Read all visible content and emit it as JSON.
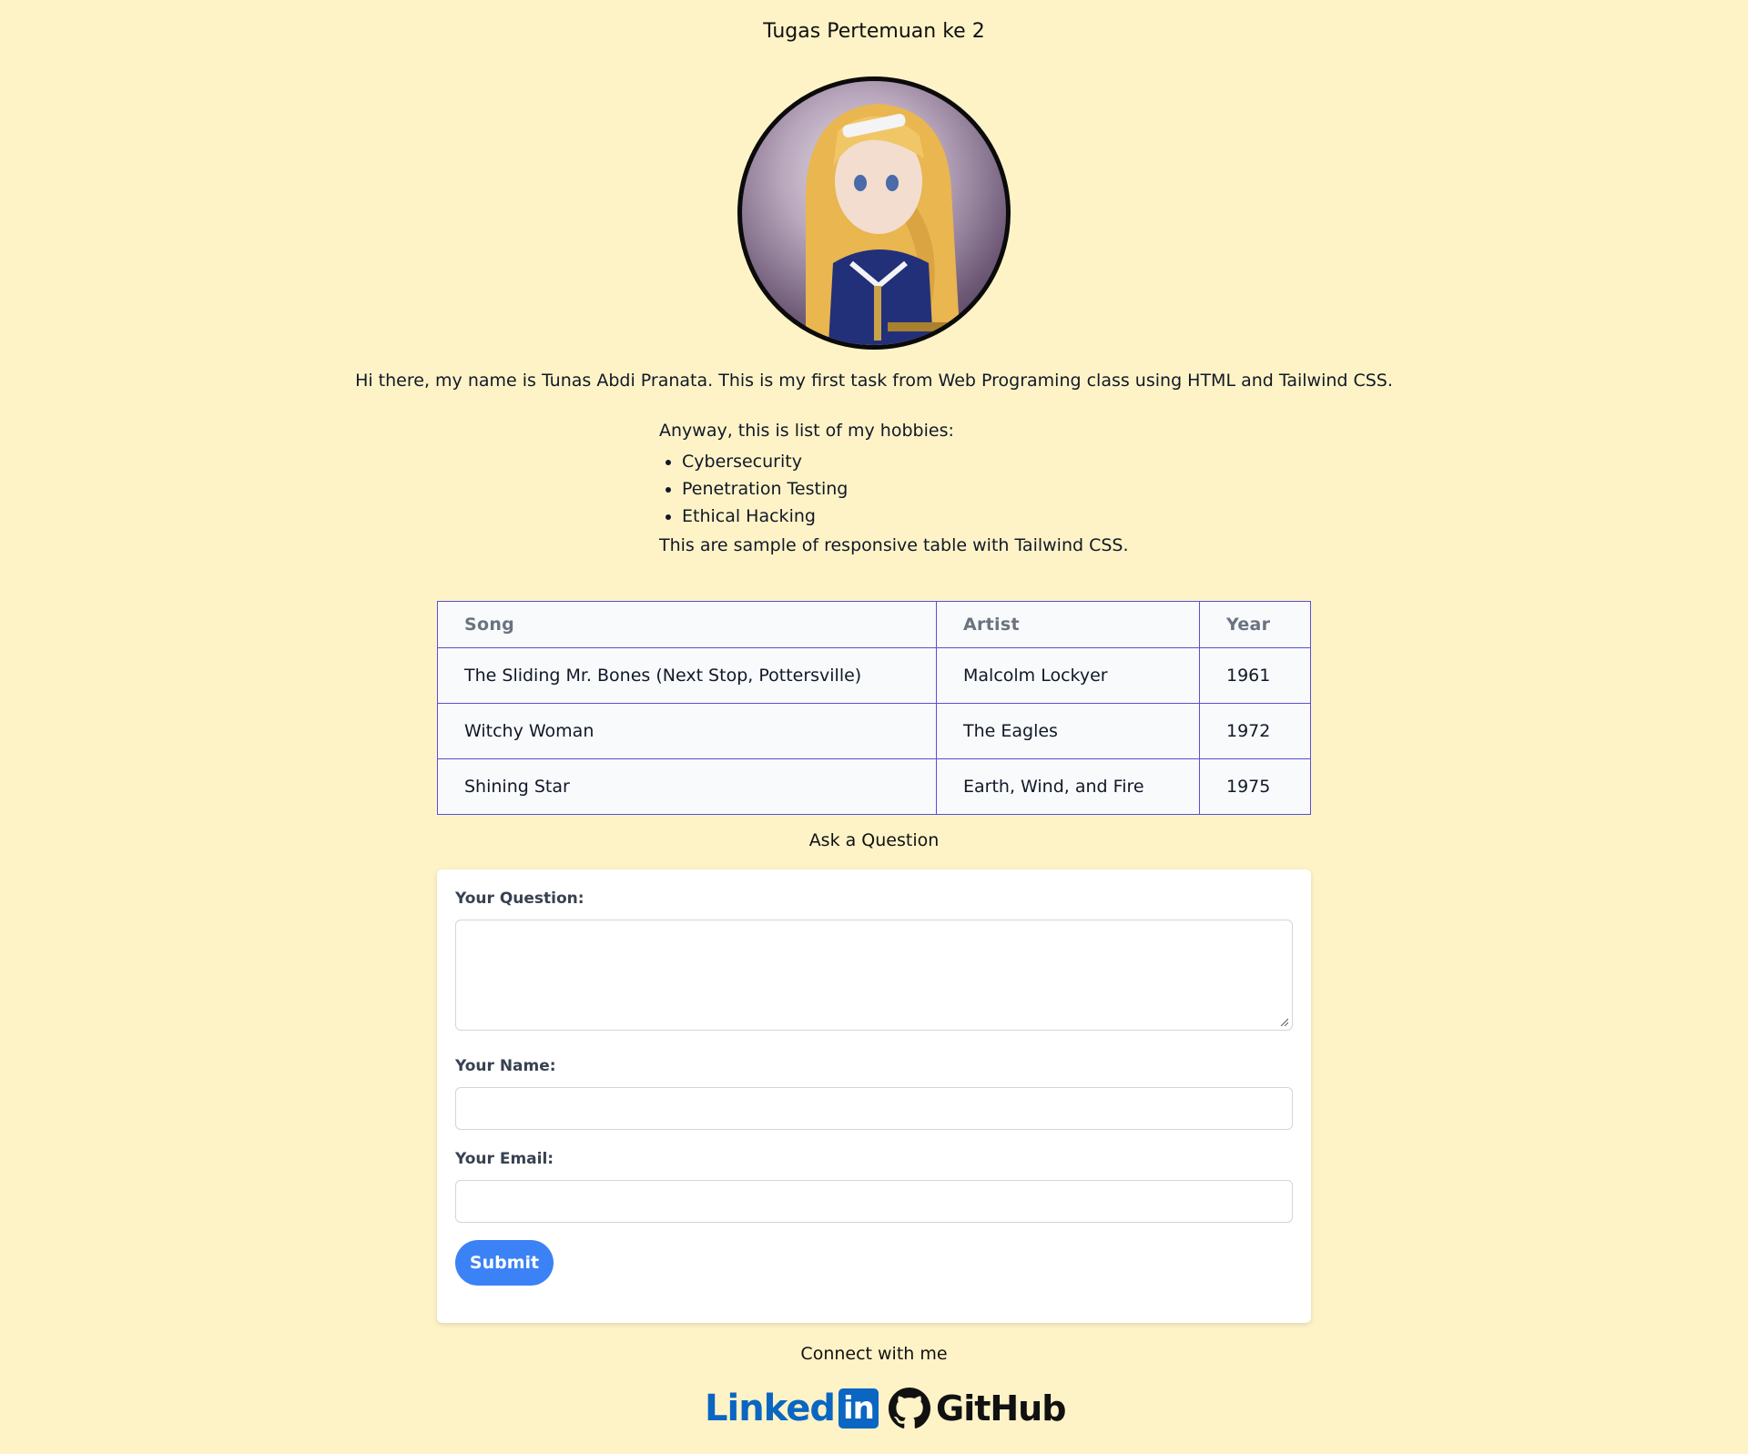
{
  "header": {
    "title": "Tugas Pertemuan ke 2"
  },
  "profile": {
    "avatar_icon": "anime-character-portrait"
  },
  "intro": {
    "text": "Hi there, my name is Tunas Abdi Pranata. This is my first task from Web Programing class using HTML and Tailwind CSS."
  },
  "hobbies": {
    "heading": "Anyway, this is list of my hobbies:",
    "items": [
      {
        "label": "Cybersecurity"
      },
      {
        "label": "Penetration Testing"
      },
      {
        "label": "Ethical Hacking"
      }
    ],
    "table_note": "This are sample of responsive table with Tailwind CSS."
  },
  "table": {
    "columns": [
      "Song",
      "Artist",
      "Year"
    ],
    "rows": [
      [
        "The Sliding Mr. Bones (Next Stop, Pottersville)",
        "Malcolm Lockyer",
        "1961"
      ],
      [
        "Witchy Woman",
        "The Eagles",
        "1972"
      ],
      [
        "Shining Star",
        "Earth, Wind, and Fire",
        "1975"
      ]
    ]
  },
  "form": {
    "title": "Ask a Question",
    "question_label": "Your Question:",
    "question_value": "",
    "name_label": "Your Name:",
    "name_value": "",
    "email_label": "Your Email:",
    "email_value": "",
    "submit_label": "Submit"
  },
  "footer": {
    "connect_text": "Connect with me",
    "linkedin_text": "Linked",
    "linkedin_box": "in",
    "github_text": "GitHub"
  },
  "colors": {
    "background": "#fef3c7",
    "table_border": "#5b4fd0",
    "button": "#3b82f6",
    "linkedin": "#0a66c2"
  }
}
